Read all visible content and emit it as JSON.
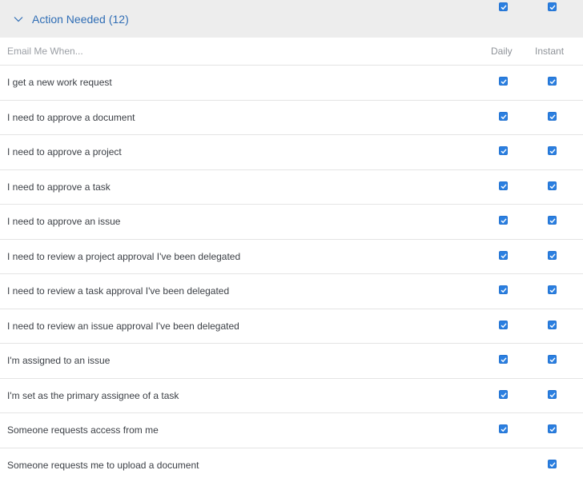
{
  "section": {
    "title": "Action Needed",
    "count": "(12)",
    "header_daily_checked": true,
    "header_instant_checked": true
  },
  "columns": {
    "label": "Email Me When...",
    "daily": "Daily",
    "instant": "Instant"
  },
  "colors": {
    "checkbox": "#2b7fe0",
    "section_title": "#2f6db5",
    "header_bg": "#ededed"
  },
  "rows": [
    {
      "label": "I get a new work request",
      "daily": true,
      "instant": true
    },
    {
      "label": "I need to approve a document",
      "daily": true,
      "instant": true
    },
    {
      "label": "I need to approve a project",
      "daily": true,
      "instant": true
    },
    {
      "label": "I need to approve a task",
      "daily": true,
      "instant": true
    },
    {
      "label": "I need to approve an issue",
      "daily": true,
      "instant": true
    },
    {
      "label": "I need to review a project approval I've been delegated",
      "daily": true,
      "instant": true
    },
    {
      "label": "I need to review a task approval I've been delegated",
      "daily": true,
      "instant": true
    },
    {
      "label": "I need to review an issue approval I've been delegated",
      "daily": true,
      "instant": true
    },
    {
      "label": "I'm assigned to an issue",
      "daily": true,
      "instant": true
    },
    {
      "label": "I'm set as the primary assignee of a task",
      "daily": true,
      "instant": true
    },
    {
      "label": "Someone requests access from me",
      "daily": true,
      "instant": true
    },
    {
      "label": "Someone requests me to upload a document",
      "daily": false,
      "instant": true
    }
  ]
}
